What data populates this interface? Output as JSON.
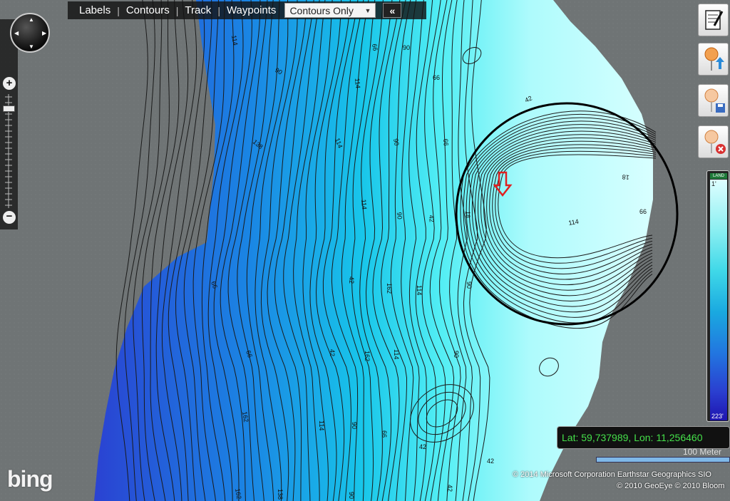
{
  "toolbar": {
    "items": [
      "Labels",
      "Contours",
      "Track",
      "Waypoints"
    ],
    "layer_selected": "Contours Only",
    "collapse_icon": "double-chevron-left-icon"
  },
  "navigation": {
    "compass_icon": "pan-compass-icon",
    "zoom_in_label": "+",
    "zoom_out_label": "−"
  },
  "tools": [
    {
      "name": "edit-notes-button",
      "icon": "notepad-pencil-icon"
    },
    {
      "name": "upload-marker-button",
      "icon": "marker-upload-icon"
    },
    {
      "name": "save-marker-button",
      "icon": "marker-save-icon"
    },
    {
      "name": "delete-marker-button",
      "icon": "marker-delete-icon"
    }
  ],
  "legend": {
    "land_label": "LAND",
    "top_value": "1'",
    "bottom_value": "223'"
  },
  "coordinates": {
    "text": "Lat: 59,737989, Lon: 11,256460"
  },
  "scale": {
    "label": "100 Meter"
  },
  "attribution": {
    "line1": "© 2014 Microsoft Corporation   Earthstar Geographics  SIO",
    "line2": "© 2010 GeoEye   © 2010 Bloom"
  },
  "logo": {
    "text": "bing"
  },
  "contour_labels": [
    "114",
    "66",
    "90",
    "114",
    "66",
    "42",
    "138",
    "114",
    "90",
    "66",
    "114",
    "90",
    "42",
    "18",
    "18",
    "66",
    "114",
    "90",
    "42",
    "162",
    "114",
    "90",
    "66",
    "42",
    "162",
    "114",
    "90",
    "66",
    "162",
    "114",
    "90",
    "66",
    "42",
    "42",
    "162",
    "138",
    "90",
    "42"
  ],
  "colors": {
    "land": "#6f7475",
    "deep": "#2a3fd0",
    "shallow": "#c8ffff",
    "coordinate_text": "#45e04a",
    "marker": "#e02020"
  }
}
